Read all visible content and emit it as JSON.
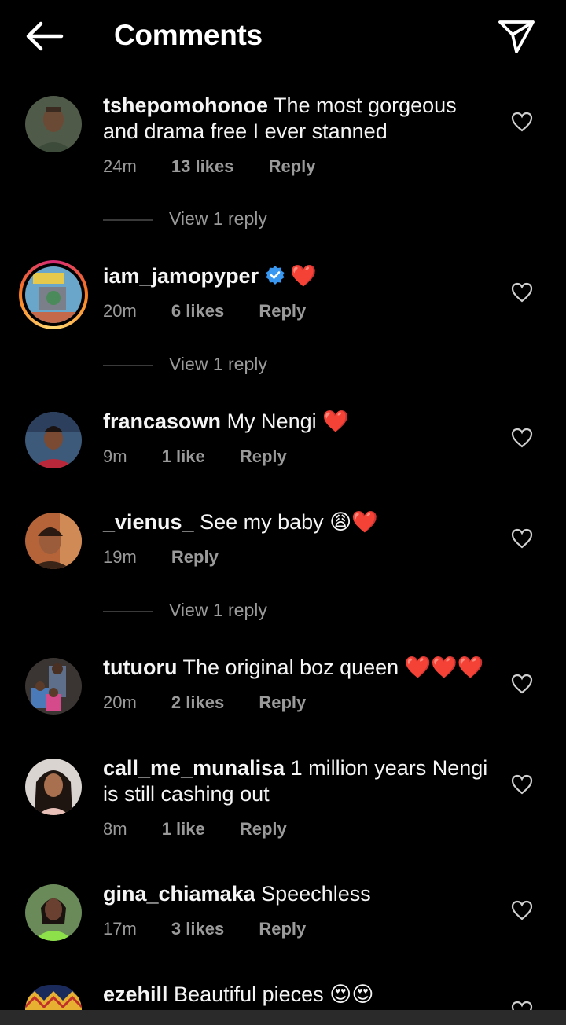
{
  "header": {
    "title": "Comments",
    "back_icon": "arrow-left-icon",
    "share_icon": "send-paper-plane-icon"
  },
  "comments": [
    {
      "username": "tshepomohonoe",
      "text": "The most gorgeous and drama free I ever stanned",
      "time": "24m",
      "likes": "13 likes",
      "reply": "Reply",
      "view_replies": "View 1 reply"
    },
    {
      "username": "iam_jamopyper",
      "verified": true,
      "text": "❤️",
      "time": "20m",
      "likes": "6 likes",
      "reply": "Reply",
      "view_replies": "View 1 reply"
    },
    {
      "username": "francasown",
      "text": "My Nengi ❤️",
      "time": "9m",
      "likes": "1 like",
      "reply": "Reply"
    },
    {
      "username": "_vienus_",
      "text": "See my baby 😩❤️",
      "time": "19m",
      "reply": "Reply",
      "view_replies": "View 1 reply"
    },
    {
      "username": "tutuoru",
      "text": "The original boz queen ❤️❤️❤️",
      "time": "20m",
      "likes": "2 likes",
      "reply": "Reply"
    },
    {
      "username": "call_me_munalisa",
      "text": "1 million years Nengi is still cashing out",
      "time": "8m",
      "likes": "1 like",
      "reply": "Reply"
    },
    {
      "username": "gina_chiamaka",
      "text": "Speechless",
      "time": "17m",
      "likes": "3 likes",
      "reply": "Reply"
    },
    {
      "username": "ezehill",
      "text": "Beautiful pieces 😍😍"
    }
  ],
  "colors": {
    "background": "#000000",
    "muted": "#9a9a9a",
    "heart": "#ed1c3a",
    "verified": "#3897f0"
  }
}
